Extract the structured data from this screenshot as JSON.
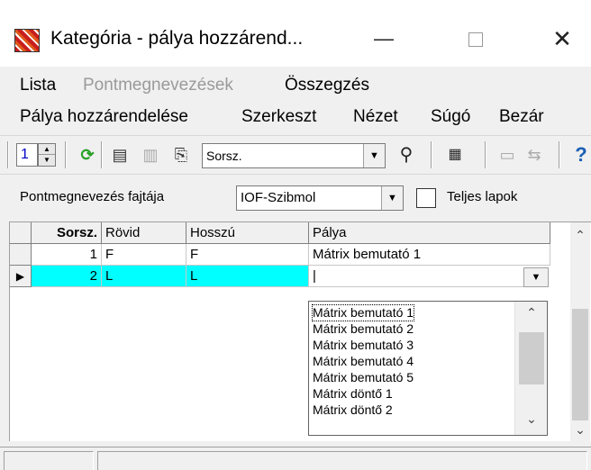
{
  "window": {
    "title": "Kategória - pálya hozzárend...",
    "minimize_glyph": "—",
    "close_glyph": "✕"
  },
  "menu_primary": {
    "lista": "Lista",
    "pontmegnevezesek": "Pontmegnevezések",
    "osszegzes": "Összegzés"
  },
  "menu_secondary": {
    "palya_hozzarendelese": "Pálya hozzárendelése",
    "szerkeszt": "Szerkeszt",
    "nezet": "Nézet",
    "sugo": "Súgó",
    "bezar": "Bezár"
  },
  "toolbar": {
    "spin_value": "1",
    "sort_combo_value": "Sorsz.",
    "icons": [
      "refresh-icon",
      "document-icon",
      "document-disabled-icon",
      "document-export-icon",
      "find-icon",
      "grid-icon",
      "help-icon"
    ]
  },
  "filter": {
    "label": "Pontmegnevezés fajtája",
    "combo_value": "IOF-Szibmol",
    "checkbox_label": "Teljes lapok",
    "checkbox_checked": false
  },
  "grid": {
    "columns": [
      "Sorsz.",
      "Rövid",
      "Hosszú",
      "Pálya"
    ],
    "rows": [
      {
        "sorsz": "1",
        "rovid": "F",
        "hosszu": "F",
        "palya": "Mátrix bemutató 1"
      },
      {
        "sorsz": "2",
        "rovid": "L",
        "hosszu": "L",
        "palya": "|"
      }
    ],
    "selected_row_color": "#00ffff"
  },
  "dropdown": {
    "items": [
      "Mátrix bemutató 1",
      "Mátrix bemutató 2",
      "Mátrix bemutató 3",
      "Mátrix bemutató 4",
      "Mátrix bemutató 5",
      "Mátrix döntő 1",
      "Mátrix döntő 2"
    ]
  }
}
